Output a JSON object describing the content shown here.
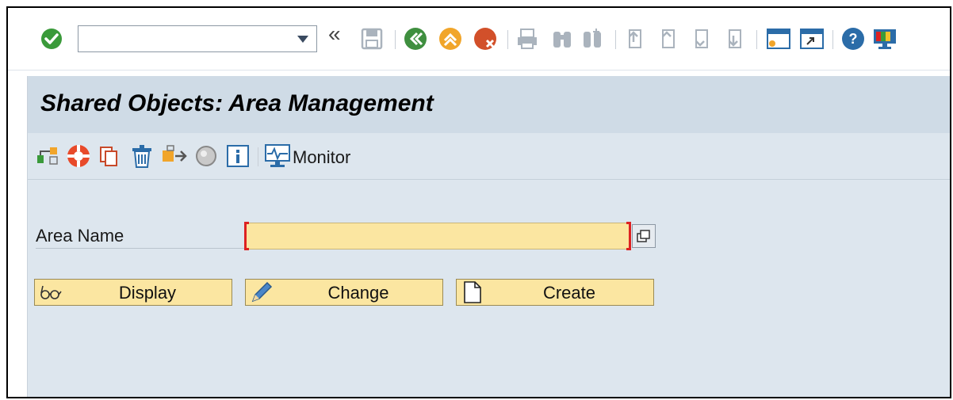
{
  "system_toolbar": {
    "command_field": {
      "value": "",
      "placeholder": ""
    },
    "icons": [
      "ok-icon",
      "command-dropdown-icon",
      "collapse-icon",
      "save-icon",
      "back-icon",
      "exit-icon",
      "cancel-icon",
      "print-icon",
      "find-icon",
      "find-next-icon",
      "first-page-icon",
      "previous-page-icon",
      "next-page-icon",
      "last-page-icon",
      "create-session-icon",
      "generate-shortcut-icon",
      "help-icon",
      "customize-layout-icon"
    ]
  },
  "title": "Shared Objects: Area Management",
  "app_toolbar": {
    "monitor_label": "Monitor"
  },
  "form": {
    "area_name_label": "Area Name",
    "area_name_value": ""
  },
  "buttons": {
    "display": "Display",
    "change": "Change",
    "create": "Create"
  },
  "colors": {
    "title_bar": "#cfdbe6",
    "background": "#dde6ee",
    "input_required": "#fbe6a1",
    "button": "#fbe6a1",
    "ok_green": "#3a9a3a",
    "back_green": "#3f8f3f",
    "exit_orange": "#f1a52a",
    "cancel_red": "#d2502a"
  }
}
